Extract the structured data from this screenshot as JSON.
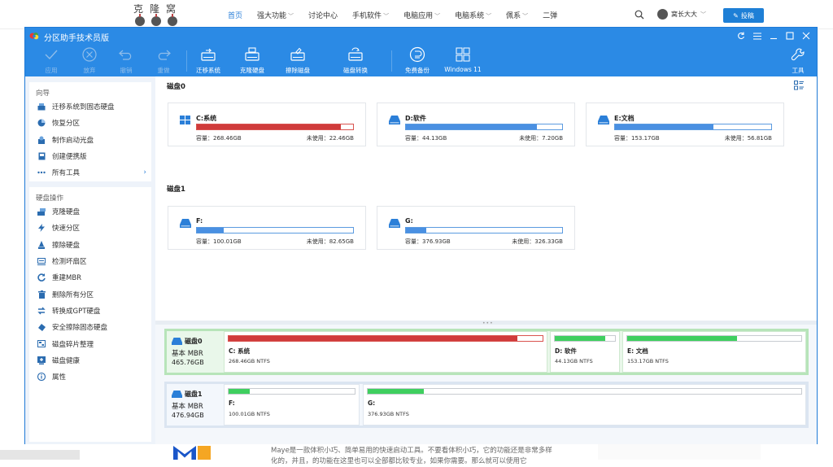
{
  "site": {
    "logo_text": "克隆窝",
    "nav": [
      {
        "label": "首页",
        "active": true,
        "caret": false
      },
      {
        "label": "强大功能",
        "active": false,
        "caret": true
      },
      {
        "label": "讨论中心",
        "active": false,
        "caret": false
      },
      {
        "label": "手机软件",
        "active": false,
        "caret": true
      },
      {
        "label": "电脑应用",
        "active": false,
        "caret": true
      },
      {
        "label": "电脑系统",
        "active": false,
        "caret": true
      },
      {
        "label": "佩系",
        "active": false,
        "caret": true
      },
      {
        "label": "二弹",
        "active": false,
        "caret": false
      }
    ],
    "user_name": "窝长大大",
    "post_label": "投稿",
    "article_line1": "Maye是一款体积小巧、简单易用的快速启动工具。不要看体积小巧，它的功能还是非常多样",
    "article_line2": "化的，并且，的功能在这里也可以全部都比较专业，如果你需要。那么就可以使用它"
  },
  "app": {
    "title": "分区助手技术员版",
    "toolbar": {
      "apply": "应用",
      "discard": "放弃",
      "undo": "撤销",
      "redo": "重做",
      "migrate": "迁移系统",
      "clone": "克隆硬盘",
      "wipe": "擦除磁盘",
      "convert": "磁盘转换",
      "backup": "免费备份",
      "win11": "Windows 11",
      "tools": "工具"
    },
    "sidebar": {
      "guide_title": "向导",
      "guide_items": [
        "迁移系统到固态硬盘",
        "恢复分区",
        "制作启动光盘",
        "创建便携版",
        "所有工具"
      ],
      "disk_ops_title": "硬盘操作",
      "disk_ops_items": [
        "克隆硬盘",
        "快速分区",
        "擦除硬盘",
        "检测坏扇区",
        "重建MBR",
        "删除所有分区",
        "转换成GPT硬盘",
        "安全擦除固态硬盘",
        "磁盘碎片整理",
        "磁盘健康",
        "属性"
      ]
    },
    "disk0": {
      "label": "磁盘0",
      "type": "基本 MBR",
      "size": "465.76GB",
      "partitions": [
        {
          "name": "C:系统",
          "capacity_label": "容量：268.46GB",
          "free_label": "未使用：22.46GB",
          "used_fraction": 0.92,
          "red": true,
          "short": "C: 系统",
          "fs_info": "268.46GB NTFS"
        },
        {
          "name": "D:软件",
          "capacity_label": "容量：44.13GB",
          "free_label": "未使用：7.20GB",
          "used_fraction": 0.84,
          "red": false,
          "short": "D: 软件",
          "fs_info": "44.13GB NTFS"
        },
        {
          "name": "E:文档",
          "capacity_label": "容量：153.17GB",
          "free_label": "未使用：56.81GB",
          "used_fraction": 0.63,
          "red": false,
          "short": "E: 文档",
          "fs_info": "153.17GB NTFS"
        }
      ]
    },
    "disk1": {
      "label": "磁盘1",
      "type": "基本 MBR",
      "size": "476.94GB",
      "partitions": [
        {
          "name": "F:",
          "capacity_label": "容量：100.01GB",
          "free_label": "未使用：82.65GB",
          "used_fraction": 0.17,
          "red": false,
          "short": "F:",
          "fs_info": "100.01GB NTFS"
        },
        {
          "name": "G:",
          "capacity_label": "容量：376.93GB",
          "free_label": "未使用：326.33GB",
          "used_fraction": 0.13,
          "red": false,
          "short": "G:",
          "fs_info": "376.93GB NTFS"
        }
      ]
    }
  },
  "colors": {
    "titlebar": "#2b8ae5",
    "bar_blue": "#4a90e2",
    "bar_red": "#d03b3b",
    "bar_green": "#3fcf5f"
  }
}
